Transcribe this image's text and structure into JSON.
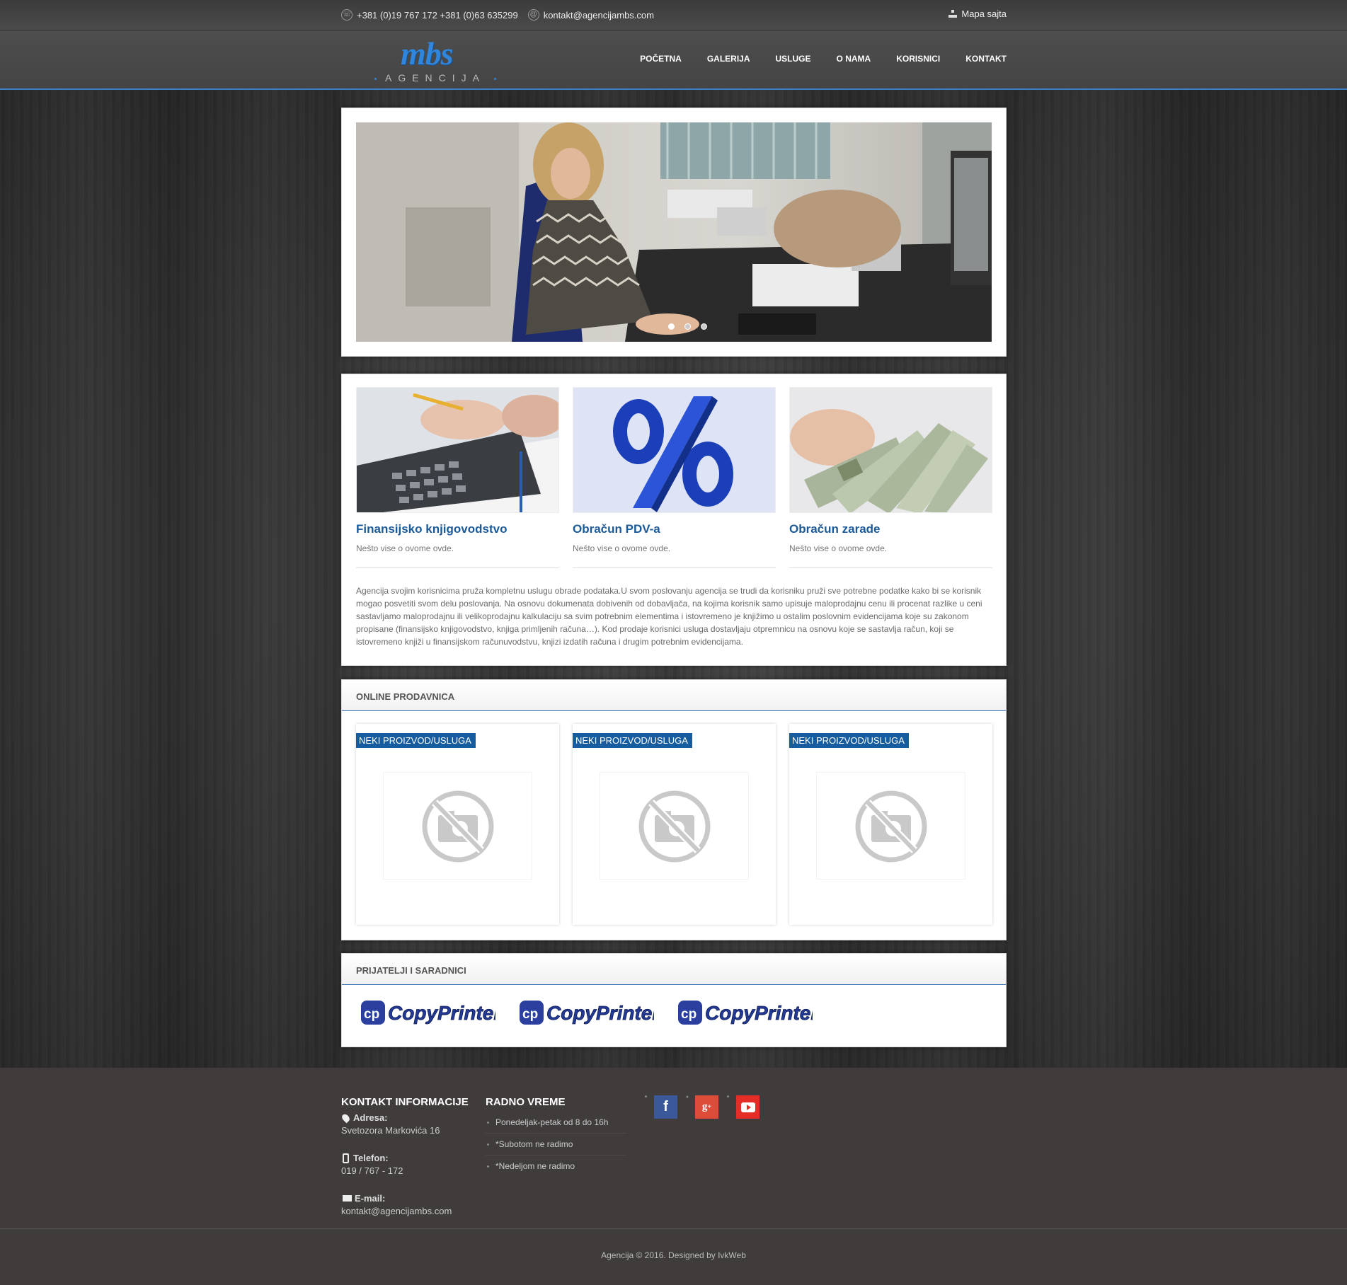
{
  "topbar": {
    "phone": "+381 (0)19 767 172 +381 (0)63 635299",
    "email": "kontakt@agencijambs.com",
    "sitemap": "Mapa sajta"
  },
  "logo": {
    "brand": "mbs",
    "sub": "AGENCIJA"
  },
  "nav": [
    {
      "label": "POČETNA"
    },
    {
      "label": "GALERIJA"
    },
    {
      "label": "USLUGE"
    },
    {
      "label": "O NAMA"
    },
    {
      "label": "KORISNICI"
    },
    {
      "label": "KONTAKT"
    }
  ],
  "slider": {
    "dots": 3,
    "active": 0
  },
  "services": [
    {
      "title": "Finansijsko knjigovodstvo",
      "desc": "Nešto vise o ovome ovde."
    },
    {
      "title": "Obračun PDV-a",
      "desc": "Nešto vise o ovome ovde."
    },
    {
      "title": "Obračun zarade",
      "desc": "Nešto vise o ovome ovde."
    }
  ],
  "services_text": "Agencija svojim korisnicima pruža kompletnu uslugu obrade podataka.U svom poslovanju agencija se trudi da korisniku pruži sve potrebne podatke kako bi se korisnik mogao posvetiti svom delu poslovanja. Na osnovu dokumenata dobivenih od dobavljača, na kojima korisnik samo upisuje maloprodajnu cenu ili procenat razlike u ceni sastavljamo maloprodajnu ili velikoprodajnu kalkulaciju sa svim potrebnim elementima i istovremeno je knjižimo u ostalim poslovnim evidencijama koje su zakonom propisane (finansijsko knjigovodstvo, knjiga primljenih računa…). Kod prodaje korisnici usluga dostavljaju otpremnicu na osnovu koje se sastavlja račun, koji se istovremeno knjiži u finansijskom računuvodstvu, knjizi izdatih računa i drugim potrebnim evidencijama.",
  "shop": {
    "title": "ONLINE PRODAVNICA",
    "products": [
      {
        "tag": "NEKI PROIZVOD/USLUGA"
      },
      {
        "tag": "NEKI PROIZVOD/USLUGA"
      },
      {
        "tag": "NEKI PROIZVOD/USLUGA"
      }
    ]
  },
  "partners": {
    "title": "PRIJATELJI I SARADNICI",
    "logos": [
      "CopyPrinters",
      "CopyPrinters",
      "CopyPrinters"
    ]
  },
  "footer": {
    "contact_title": "KONTAKT INFORMACIJE",
    "address_label": "Adresa:",
    "address": "Svetozora Markovića 16",
    "phone_label": "Telefon:",
    "phone": "019 / 767 - 172",
    "email_label": "E-mail:",
    "email": "kontakt@agencijambs.com",
    "hours_title": "RADNO VREME",
    "hours": [
      "Ponedeljak-petak od 8 do 16h",
      "*Subotom ne radimo",
      "*Nedeljom ne radimo"
    ],
    "social": [
      "facebook-icon",
      "google-plus-icon",
      "youtube-icon"
    ],
    "social_colors": [
      "#3b5998",
      "#dd4b39",
      "#e52d27"
    ]
  },
  "copyright": "Agencija © 2016. Designed by IvkWeb"
}
